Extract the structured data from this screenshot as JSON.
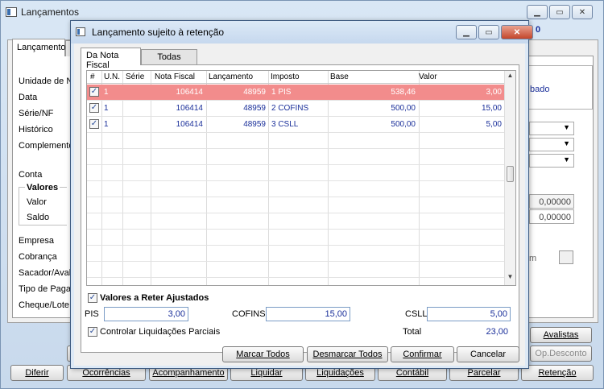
{
  "main": {
    "title": "Lançamentos",
    "number": "0",
    "tab_label": "Lançamento",
    "labels": {
      "unidade": "Unidade de Neg",
      "data": "Data",
      "serie": "Série/NF",
      "historico": "Histórico",
      "complemento": "Complemento",
      "conta": "Conta",
      "valores": "Valores",
      "valor": "Valor",
      "saldo": "Saldo",
      "empresa": "Empresa",
      "cobranca": "Cobrança",
      "sacador": "Sacador/Avalist",
      "tipo_pagamento": "Tipo de Pagame",
      "cheque": "Cheque/Lote"
    },
    "right_status": "bado",
    "right_value_1": "0,00000",
    "right_value_2": "0,00000",
    "right_m": "m",
    "buttons": {
      "avalistas": "Avalistas",
      "op_desconto": "Op.Desconto",
      "diferir": "Diferir",
      "ocorrencias": "Ocorrências",
      "acompanhamento": "Acompanhamento",
      "liquidar": "Liquidar",
      "liquidacoes": "Liquidações",
      "contabil": "Contábil",
      "parcelar": "Parcelar",
      "retencao": "Retenção"
    }
  },
  "dialog": {
    "title": "Lançamento sujeito à retenção",
    "tabs": [
      "Da Nota Fiscal",
      "Todas"
    ],
    "columns": [
      "#",
      "U.N.",
      "Série",
      "Nota Fiscal",
      "Lançamento",
      "Imposto",
      "Base",
      "Valor"
    ],
    "rows": [
      {
        "checked": true,
        "un": "1",
        "serie": "",
        "nf": "106414",
        "lanc": "48959",
        "imposto": "1 PIS",
        "base": "538,46",
        "valor": "3,00",
        "selected": true
      },
      {
        "checked": true,
        "un": "1",
        "serie": "",
        "nf": "106414",
        "lanc": "48959",
        "imposto": "2 COFINS",
        "base": "500,00",
        "valor": "15,00",
        "selected": false
      },
      {
        "checked": true,
        "un": "1",
        "serie": "",
        "nf": "106414",
        "lanc": "48959",
        "imposto": "3 CSLL",
        "base": "500,00",
        "valor": "5,00",
        "selected": false
      }
    ],
    "ajustados_label": "Valores a Reter Ajustados",
    "pis_label": "PIS",
    "pis_value": "3,00",
    "cofins_label": "COFINS",
    "cofins_value": "15,00",
    "csll_label": "CSLL",
    "csll_value": "5,00",
    "controlar_label": "Controlar Liquidações Parciais",
    "total_label": "Total",
    "total_value": "23,00",
    "buttons": {
      "marcar": "Marcar Todos",
      "desmarcar": "Desmarcar Todos",
      "confirmar": "Confirmar",
      "cancelar": "Cancelar"
    }
  }
}
